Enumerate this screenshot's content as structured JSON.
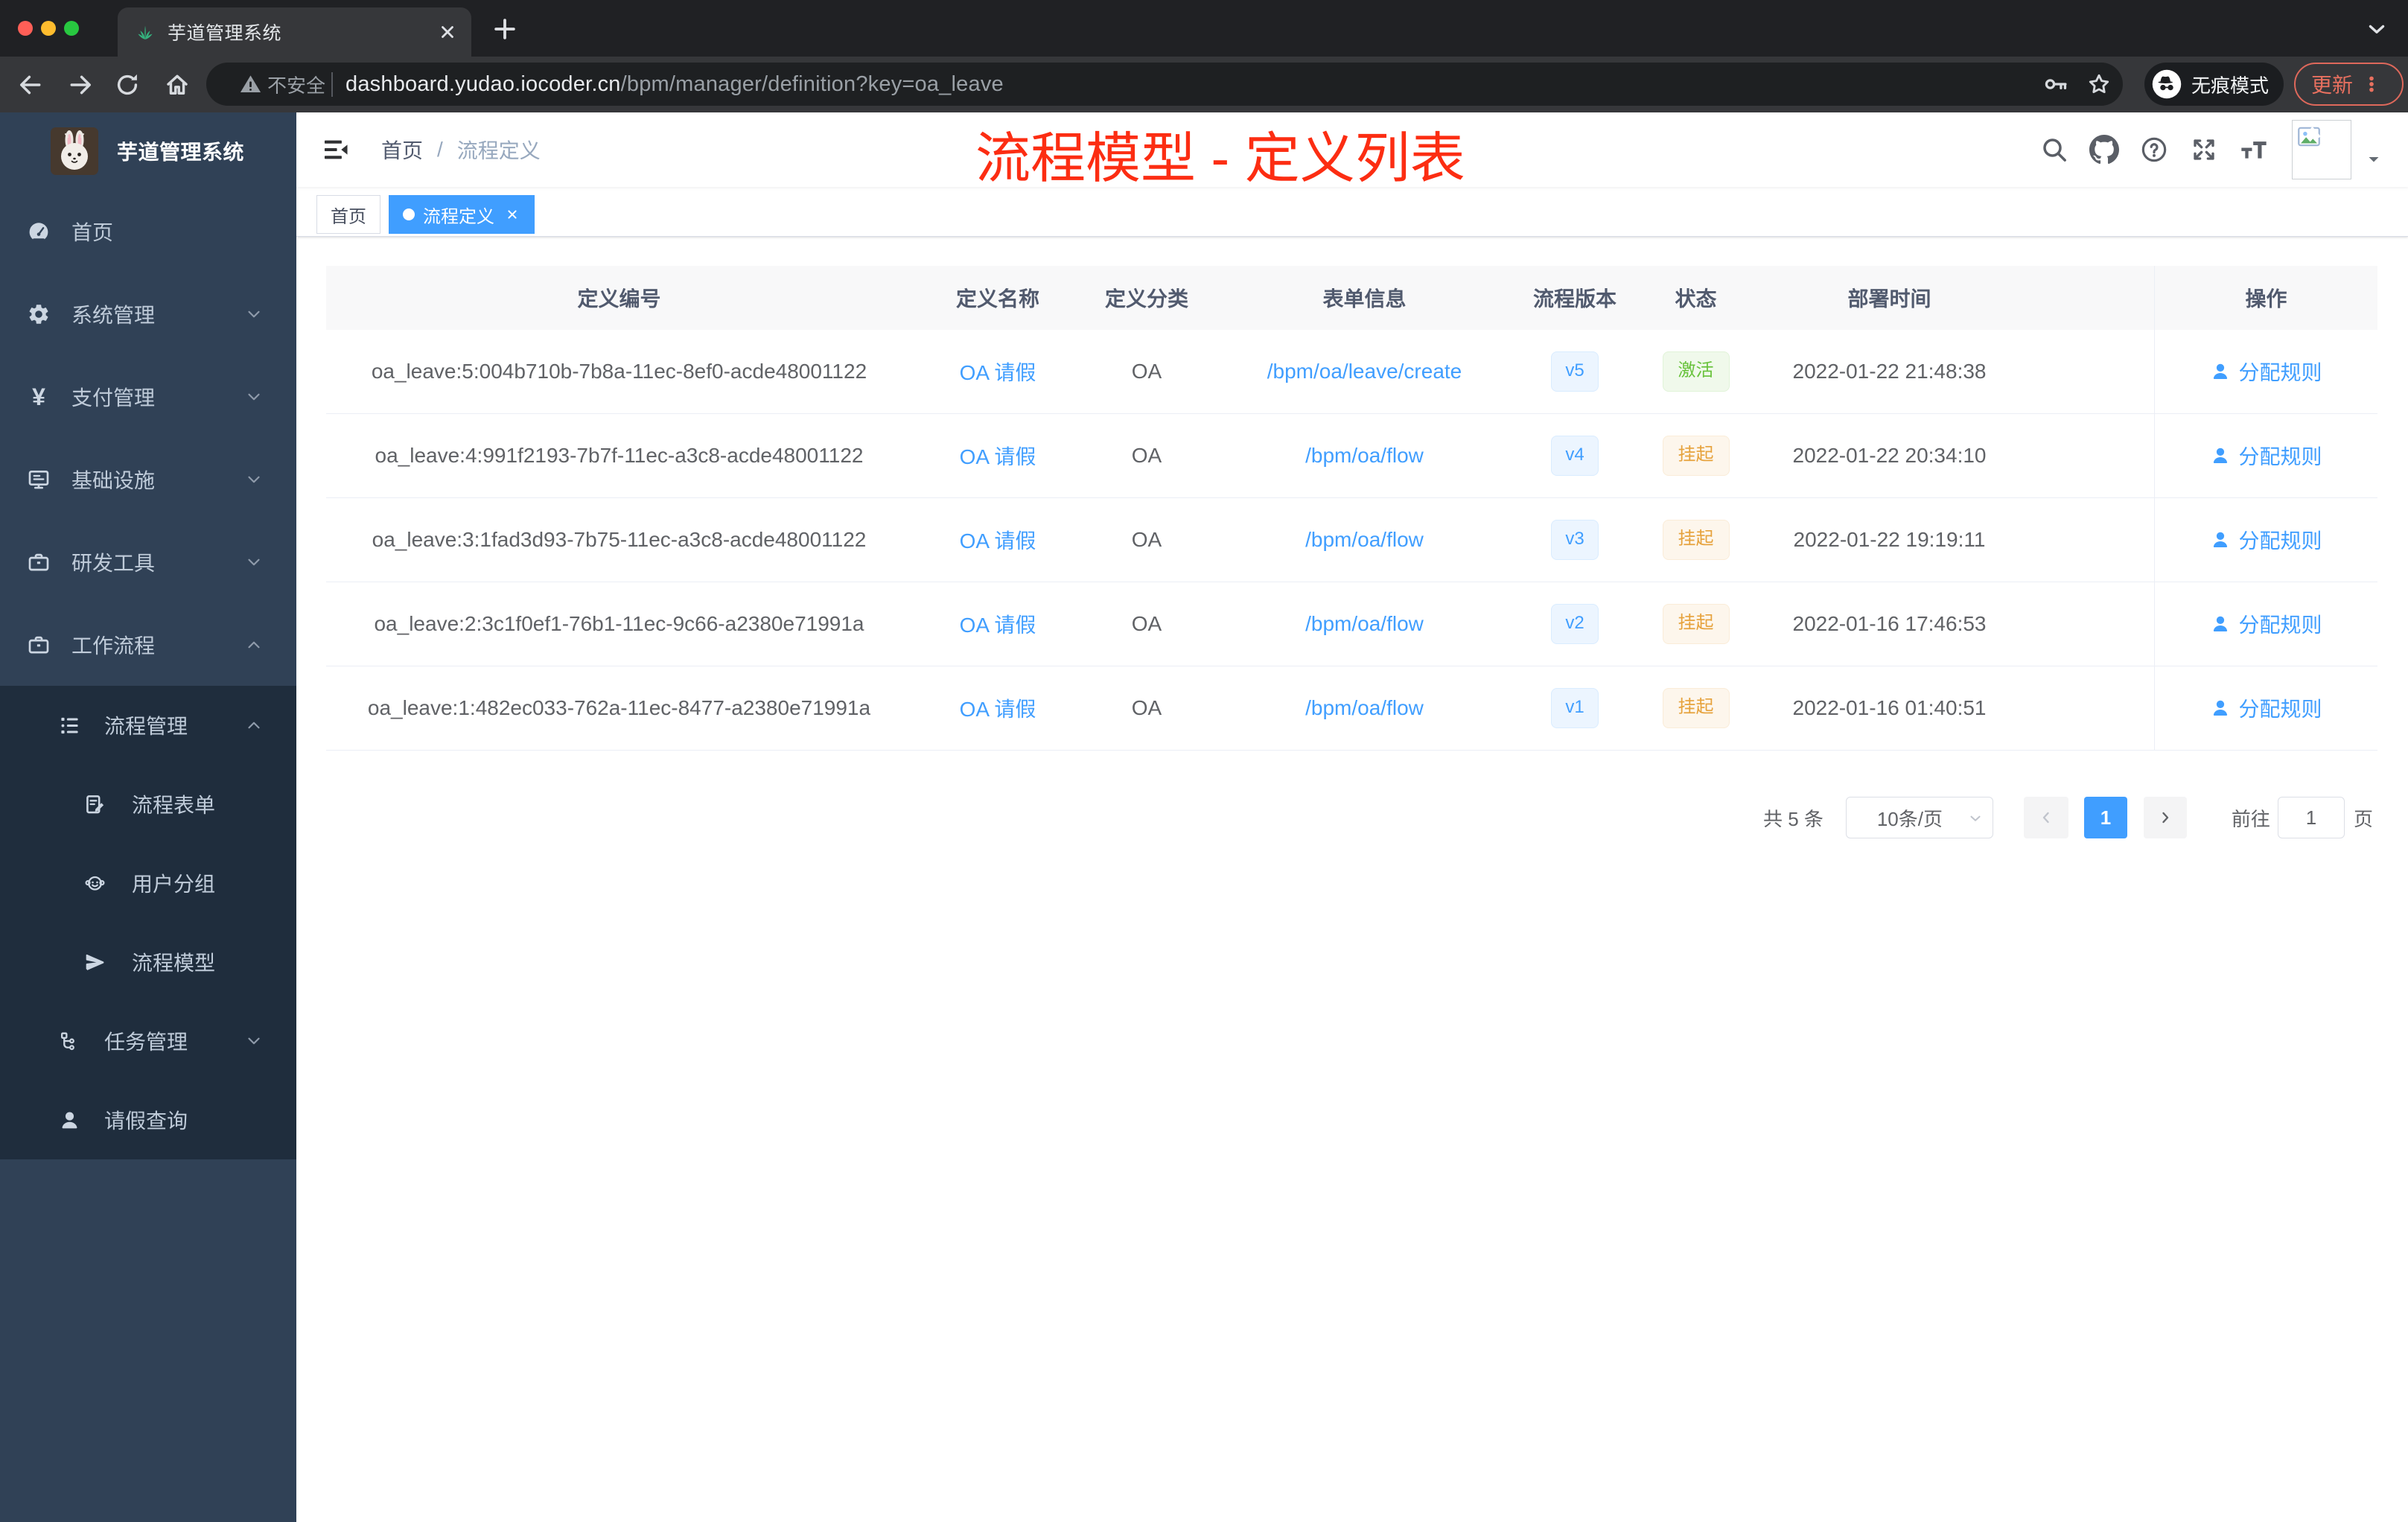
{
  "browser": {
    "tab_title": "芋道管理系统",
    "address": {
      "security_label": "不安全",
      "host": "dashboard.yudao.iocoder.cn",
      "path": "/bpm/manager/definition?key=oa_leave"
    },
    "incognito_label": "无痕模式",
    "update_label": "更新"
  },
  "sidebar": {
    "logo_title": "芋道管理系统",
    "menu": [
      {
        "label": "首页",
        "icon": "dashboard-icon",
        "level": 1
      },
      {
        "label": "系统管理",
        "icon": "gear-icon",
        "level": 1,
        "arrow": "down"
      },
      {
        "label": "支付管理",
        "icon": "yen-icon",
        "level": 1,
        "arrow": "down"
      },
      {
        "label": "基础设施",
        "icon": "monitor-icon",
        "level": 1,
        "arrow": "down"
      },
      {
        "label": "研发工具",
        "icon": "briefcase-icon",
        "level": 1,
        "arrow": "down"
      },
      {
        "label": "工作流程",
        "icon": "briefcase-icon",
        "level": 1,
        "arrow": "up"
      },
      {
        "label": "流程管理",
        "icon": "tree-table-icon",
        "level": 2,
        "arrow": "up"
      },
      {
        "label": "流程表单",
        "icon": "form-icon",
        "level": 3
      },
      {
        "label": "用户分组",
        "icon": "peoples-icon",
        "level": 3
      },
      {
        "label": "流程模型",
        "icon": "guide-icon",
        "level": 3
      },
      {
        "label": "任务管理",
        "icon": "tree-icon",
        "level": 2,
        "arrow": "down"
      },
      {
        "label": "请假查询",
        "icon": "user-icon",
        "level": 2
      }
    ]
  },
  "navbar": {
    "breadcrumb": {
      "items": [
        "首页",
        "流程定义"
      ],
      "separator": "/"
    }
  },
  "annotation": {
    "text": "流程模型 - 定义列表",
    "color": "#fb3a20"
  },
  "tags_view": {
    "tags": [
      {
        "label": "首页",
        "active": false
      },
      {
        "label": "流程定义",
        "active": true
      }
    ]
  },
  "table": {
    "columns": [
      "定义编号",
      "定义名称",
      "定义分类",
      "表单信息",
      "流程版本",
      "状态",
      "部署时间",
      "操作"
    ],
    "rows": [
      {
        "id": "oa_leave:5:004b710b-7b8a-11ec-8ef0-acde48001122",
        "name": "OA 请假",
        "category": "OA",
        "form": "/bpm/oa/leave/create",
        "version": "v5",
        "status": "激活",
        "status_type": "success",
        "deploy_time": "2022-01-22 21:48:38",
        "action": "分配规则"
      },
      {
        "id": "oa_leave:4:991f2193-7b7f-11ec-a3c8-acde48001122",
        "name": "OA 请假",
        "category": "OA",
        "form": "/bpm/oa/flow",
        "version": "v4",
        "status": "挂起",
        "status_type": "warning",
        "deploy_time": "2022-01-22 20:34:10",
        "action": "分配规则"
      },
      {
        "id": "oa_leave:3:1fad3d93-7b75-11ec-a3c8-acde48001122",
        "name": "OA 请假",
        "category": "OA",
        "form": "/bpm/oa/flow",
        "version": "v3",
        "status": "挂起",
        "status_type": "warning",
        "deploy_time": "2022-01-22 19:19:11",
        "action": "分配规则"
      },
      {
        "id": "oa_leave:2:3c1f0ef1-76b1-11ec-9c66-a2380e71991a",
        "name": "OA 请假",
        "category": "OA",
        "form": "/bpm/oa/flow",
        "version": "v2",
        "status": "挂起",
        "status_type": "warning",
        "deploy_time": "2022-01-16 17:46:53",
        "action": "分配规则"
      },
      {
        "id": "oa_leave:1:482ec033-762a-11ec-8477-a2380e71991a",
        "name": "OA 请假",
        "category": "OA",
        "form": "/bpm/oa/flow",
        "version": "v1",
        "status": "挂起",
        "status_type": "warning",
        "deploy_time": "2022-01-16 01:40:51",
        "action": "分配规则"
      }
    ]
  },
  "pagination": {
    "total_label": "共 5 条",
    "page_size_label": "10条/页",
    "current_page": "1",
    "goto_label": "前往",
    "goto_value": "1",
    "page_unit": "页"
  },
  "colors": {
    "primary": "#409eff",
    "sidebar_bg": "#304156",
    "sidebar_sub_bg": "#1f2d3d",
    "tag_success_text": "#67c23a",
    "tag_warning_text": "#e6a23c",
    "annotation_red": "#fb3a20"
  }
}
